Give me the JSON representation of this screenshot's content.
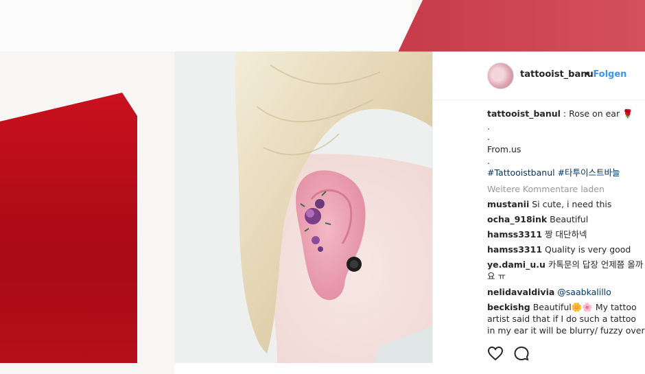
{
  "post": {
    "username": "tattooist_banul",
    "follow_label": "Folgen"
  },
  "caption": {
    "user": "tattooist_banul",
    "text": " : Rose on ear 🌹",
    "dot1": ".",
    "dot2": ".",
    "line_from": "From.us",
    "dot3": ".",
    "hashtags": "#Tattooistbanul #타투이스트바늘"
  },
  "load_more_label": "Weitere Kommentare laden",
  "comments": [
    {
      "user": "mustanii",
      "text": " Si cute, i need this"
    },
    {
      "user": "ocha_918ink",
      "text": " Beautiful"
    },
    {
      "user": "hamss3311",
      "text": " 짱 대단하넥"
    },
    {
      "user": "hamss3311",
      "text": " Quality is very good"
    },
    {
      "user": "ye.dami_u.u",
      "text": " 카톡문의 답장 언제쯤 올까요 ㅠ"
    },
    {
      "user": "nelidavaldivia",
      "text": "@saabkalillo"
    },
    {
      "user": "beckishg",
      "text": " Beautiful🌼🌸 My tattoo artist said that if I do such a tattoo in my ear it will be blurry/ fuzzy over the years to come , do you agree?"
    }
  ],
  "icons": {
    "like": "heart-icon",
    "comment": "comment-icon"
  },
  "colors": {
    "accent_red": "#c9101e",
    "follow_blue": "#3897f0",
    "link_navy": "#003569"
  }
}
